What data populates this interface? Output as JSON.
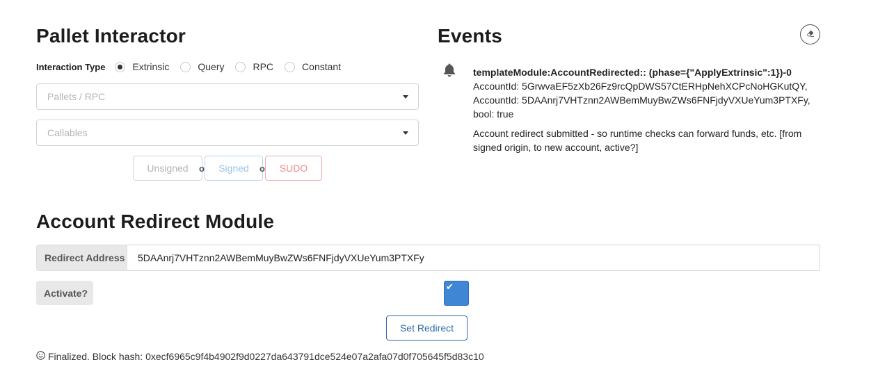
{
  "pallet_interactor": {
    "title": "Pallet Interactor",
    "interaction_type_label": "Interaction Type",
    "options": [
      {
        "label": "Extrinsic",
        "checked": true
      },
      {
        "label": "Query",
        "checked": false
      },
      {
        "label": "RPC",
        "checked": false
      },
      {
        "label": "Constant",
        "checked": false
      }
    ],
    "pallets_placeholder": "Pallets / RPC",
    "callables_placeholder": "Callables",
    "buttons": {
      "unsigned": "Unsigned",
      "signed": "Signed",
      "sudo": "SUDO",
      "or": "or"
    }
  },
  "events": {
    "title": "Events",
    "clear_icon": "eraser-icon",
    "items": [
      {
        "icon": "bell-icon",
        "heading": "templateModule:AccountRedirected:: (phase={\"ApplyExtrinsic\":1})-0",
        "params": "AccountId: 5GrwvaEF5zXb26Fz9rcQpDWS57CtERHpNehXCPcNoHGKutQY, AccountId: 5DAAnrj7VHTznn2AWBemMuyBwZWs6FNFjdyVXUeYum3PTXFy, bool: true",
        "description": "Account redirect submitted - so runtime checks can forward funds, etc. [from signed origin, to new account, active?]"
      }
    ]
  },
  "account_redirect": {
    "title": "Account Redirect Module",
    "redirect_label": "Redirect Address",
    "redirect_value": "5DAAnrj7VHTznn2AWBemMuyBwZWs6FNFjdyVXUeYum3PTXFy",
    "activate_label": "Activate?",
    "activate_checked": true,
    "set_button": "Set Redirect"
  },
  "status": {
    "icon": "smile-icon",
    "text": "Finalized. Block hash: 0xecf6965c9f4b4902f9d0227da643791dce524e07a2afa07d0f705645f5d83c10"
  },
  "colors": {
    "checkbox": "#3f86d4",
    "primary_outline": "#2e6ba8",
    "signed": "#9ac4e8",
    "sudo": "#ef8a8a"
  }
}
